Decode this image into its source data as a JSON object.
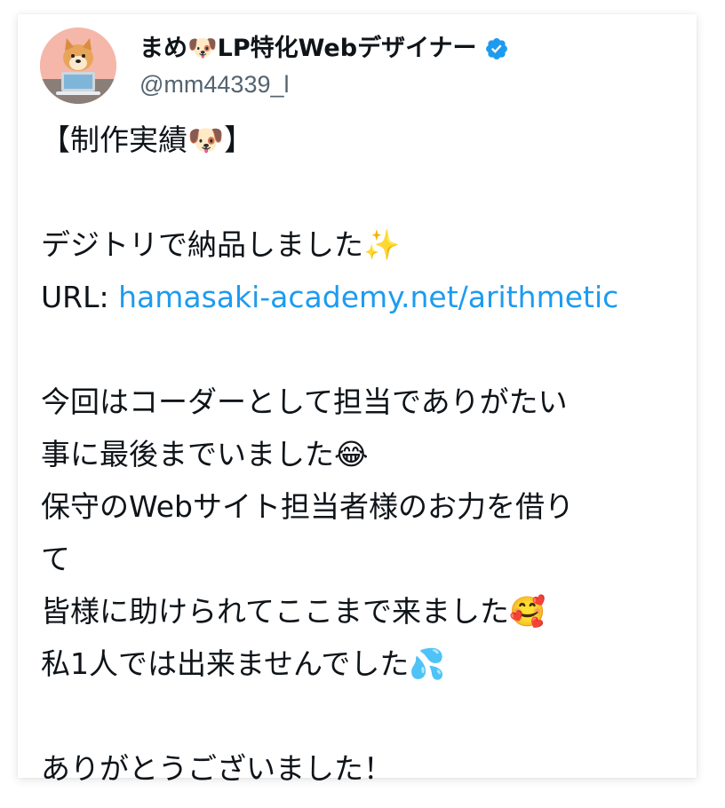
{
  "author": {
    "display_name": "まめ🐶LP特化Webデザイナー",
    "handle": "@mm44339_l",
    "verified": true,
    "avatar_icon": "dog-at-laptop-avatar",
    "verified_icon": "verified-badge-icon",
    "accent_color": "#1d9bf0"
  },
  "post": {
    "line1": "【制作実績🐶】",
    "line2": "デジトリで納品しました✨",
    "url_label": "URL: ",
    "url_text": "hamasaki-academy.net/arithmetic",
    "line3": "今回はコーダーとして担当でありがたい",
    "line4": "事に最後までいました😂",
    "line5": "保守のWebサイト担当者様のお力を借り",
    "line6": "て",
    "line7": "皆様に助けられてここまで来ました🥰",
    "line8": "私1人では出来ませんでした💦",
    "line9": "ありがとうございました！"
  }
}
